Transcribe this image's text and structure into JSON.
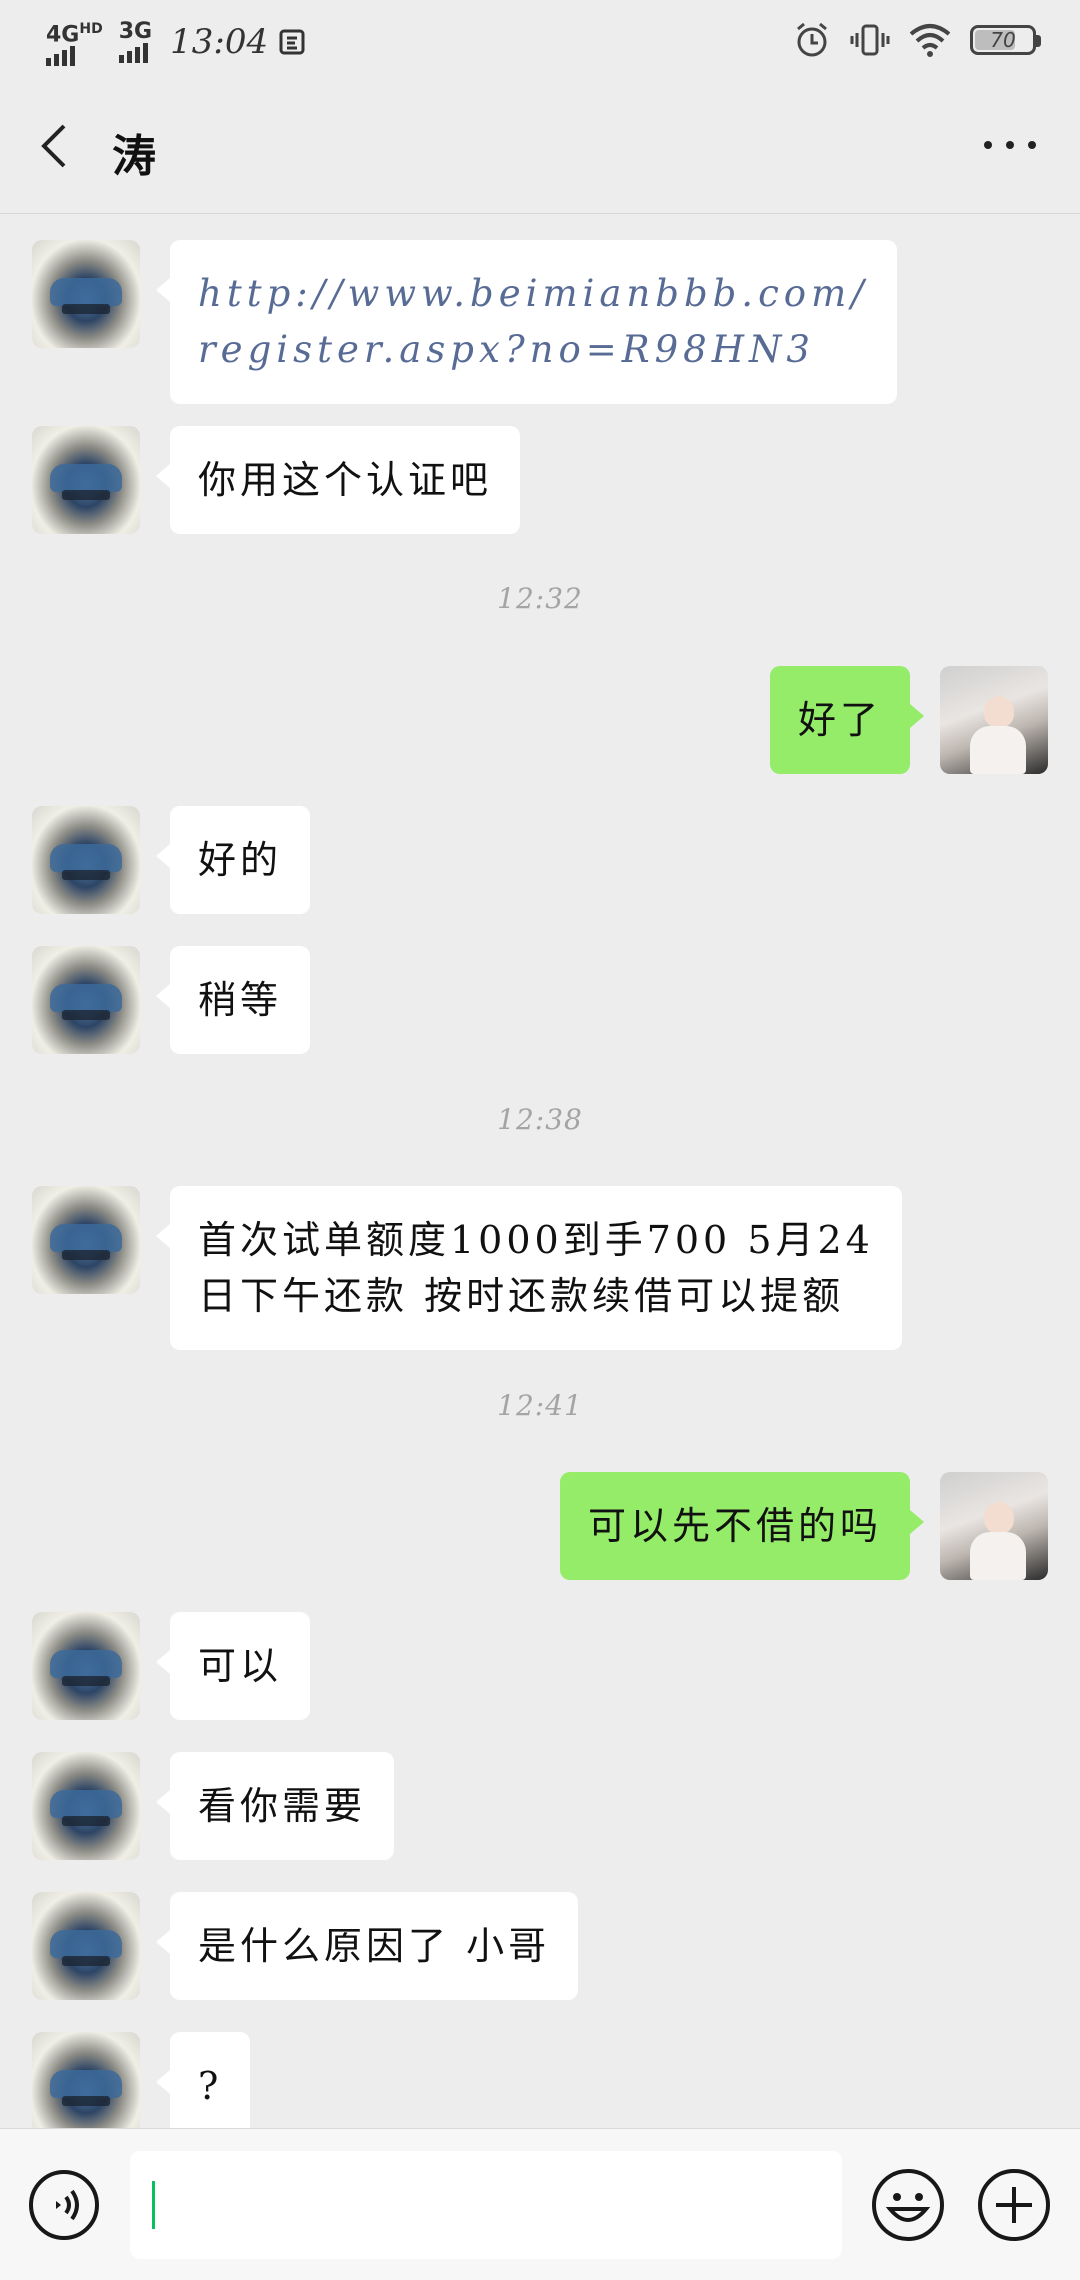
{
  "status_bar": {
    "network_1": "4G",
    "network_1_sup": "HD",
    "network_2": "3G",
    "time": "13:04",
    "battery": "70"
  },
  "header": {
    "title": "涛"
  },
  "messages": [
    {
      "side": "left",
      "type": "link",
      "lines": [
        "http://www.beimianbbb.com/",
        "register.aspx?no=R98HN3"
      ]
    },
    {
      "side": "left",
      "text": "你用这个认证吧"
    },
    {
      "timestamp": "12:32"
    },
    {
      "side": "right",
      "text": "好了"
    },
    {
      "side": "left",
      "text": "好的"
    },
    {
      "side": "left",
      "text": "稍等"
    },
    {
      "timestamp": "12:38"
    },
    {
      "side": "left",
      "lines": [
        "首次试单额度1000到手700 5月24",
        "日下午还款 按时还款续借可以提额"
      ]
    },
    {
      "timestamp": "12:41"
    },
    {
      "side": "right",
      "text": "可以先不借的吗"
    },
    {
      "side": "left",
      "text": "可以"
    },
    {
      "side": "left",
      "text": "看你需要"
    },
    {
      "side": "left",
      "text": "是什么原因了 小哥"
    },
    {
      "side": "left",
      "text": "?"
    }
  ],
  "input_bar": {
    "value": ""
  },
  "colors": {
    "background": "#ededed",
    "my_bubble": "#95ec69",
    "other_bubble": "#ffffff",
    "link": "#576b95",
    "caret": "#07c160"
  },
  "icons": [
    "back-arrow-icon",
    "more-dots-icon",
    "voice-icon",
    "emoji-icon",
    "plus-icon",
    "alarm-icon",
    "vibrate-icon",
    "wifi-icon",
    "battery-icon"
  ]
}
